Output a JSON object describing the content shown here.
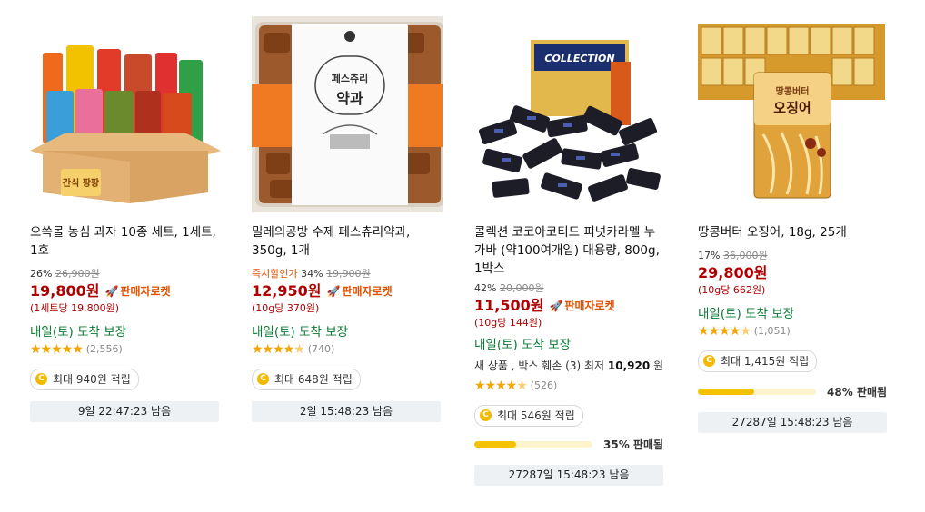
{
  "products": [
    {
      "title": "으쓱몰 농심 과자 10종 세트, 1세트, 1호",
      "discount": "26%",
      "original_price": "26,900원",
      "price": "19,800원",
      "rocket": "판매자로켓",
      "unit_price": "(1세트당 19,800원)",
      "arrival": "내일(토) 도착 보장",
      "rating_count": "(2,556)",
      "reward": "최대 940원 적립",
      "timer": "9일 22:47:23 남음",
      "box_text": "간식 팡팡"
    },
    {
      "title": "밀레의공방 수제 페스츄리약과, 350g, 1개",
      "pre_label": "즉시할인가",
      "discount": "34%",
      "original_price": "19,900원",
      "price": "12,950원",
      "rocket": "판매자로켓",
      "unit_price": "(10g당 370원)",
      "arrival": "내일(토) 도착 보장",
      "rating_count": "(740)",
      "reward": "최대 648원 적립",
      "timer": "2일 15:48:23 남음",
      "label_title": "페스츄리",
      "label_sub": "약과"
    },
    {
      "title": "콜렉션 코코아코티드 피넛카라멜 누가바 (약100여개입) 대용량, 800g, 1박스",
      "discount": "42%",
      "original_price": "20,000원",
      "price": "11,500원",
      "rocket": "판매자로켓",
      "unit_price": "(10g당 144원)",
      "arrival": "내일(토) 도착 보장",
      "extra_prefix": "새 상품 , 박스 훼손 (3) 최저",
      "extra_price": "10,920",
      "extra_suffix": "원",
      "rating_count": "(526)",
      "reward": "최대 546원 적립",
      "sold_percent": 35,
      "sold_text": "35% 판매됨",
      "timer": "27287일 15:48:23 남음",
      "box_text": "COLLECTION"
    },
    {
      "title": "땅콩버터 오징어, 18g, 25개",
      "discount": "17%",
      "original_price": "36,000원",
      "price": "29,800원",
      "unit_price": "(10g당 662원)",
      "arrival": "내일(토) 도착 보장",
      "rating_count": "(1,051)",
      "reward": "최대 1,415원 적립",
      "sold_percent": 48,
      "sold_text": "48% 판매됨",
      "timer": "27287일 15:48:23 남음",
      "pack_text1": "땅콩버터",
      "pack_text2": "오징어"
    }
  ],
  "colors": {
    "price": "#ae0000",
    "rocket": "#e25000",
    "arrival": "#0b7a34",
    "star": "#f5a500",
    "sold_bar": "#f4c200"
  }
}
